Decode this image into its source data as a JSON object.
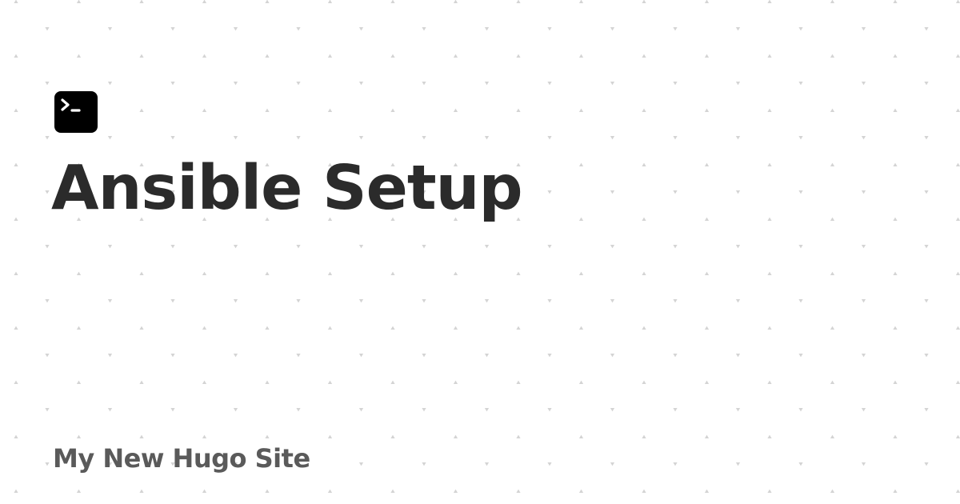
{
  "card": {
    "title": "Ansible Setup",
    "site_name": "My New Hugo Site",
    "logo_icon": "terminal-icon"
  },
  "colors": {
    "background": "#ffffff",
    "title": "#2b2b2b",
    "site_name": "#5a5a5a",
    "logo": "#000000",
    "pattern": "#d4d4d4"
  }
}
